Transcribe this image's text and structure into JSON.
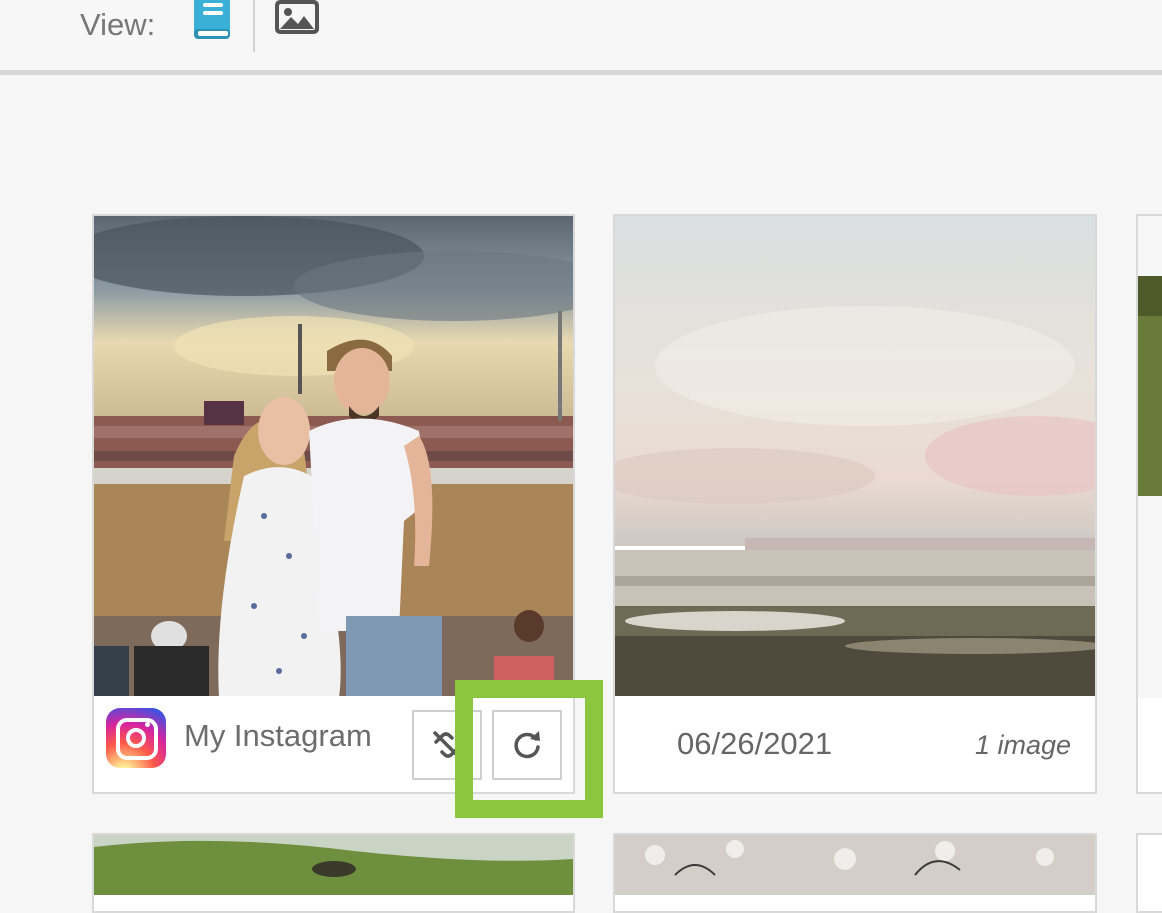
{
  "view_bar": {
    "label": "View:",
    "options": [
      {
        "name": "book-view",
        "icon": "book-icon",
        "active": true,
        "color": "#3ab0d6"
      },
      {
        "name": "image-view",
        "icon": "image-icon",
        "active": false,
        "color": "#555555"
      }
    ]
  },
  "cards": [
    {
      "source_icon": "instagram-icon",
      "source_name": "My Instagram",
      "actions": [
        {
          "label": "unlink",
          "icon": "unlink-icon"
        },
        {
          "label": "refresh",
          "icon": "refresh-icon"
        }
      ]
    },
    {
      "date": "06/26/2021",
      "count": "1 image"
    }
  ],
  "colors": {
    "highlight": "#8cc63f",
    "accent": "#3ab0d6"
  }
}
